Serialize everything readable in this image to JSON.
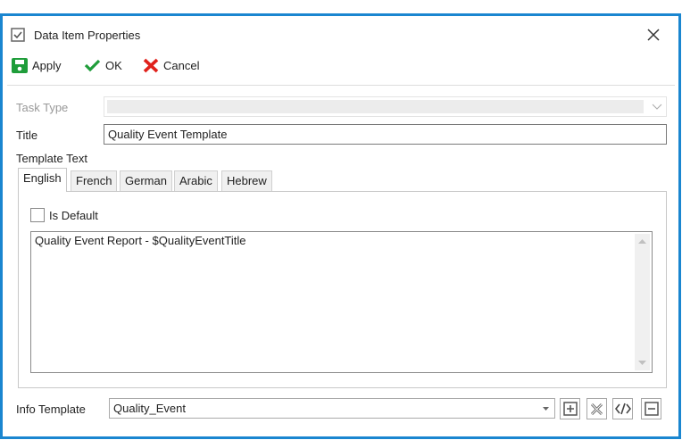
{
  "window": {
    "title": "Data Item Properties"
  },
  "toolbar": {
    "apply": "Apply",
    "ok": "OK",
    "cancel": "Cancel"
  },
  "form": {
    "task_type_label": "Task Type",
    "task_type_value": "",
    "title_label": "Title",
    "title_value": "Quality Event Template",
    "template_text_label": "Template Text",
    "tabs": [
      {
        "label": "English"
      },
      {
        "label": "French"
      },
      {
        "label": "German"
      },
      {
        "label": "Arabic"
      },
      {
        "label": "Hebrew"
      }
    ],
    "is_default_label": "Is Default",
    "is_default_checked": false,
    "template_body": "Quality Event Report - $QualityEventTitle",
    "info_template_label": "Info Template",
    "info_template_value": "Quality_Event"
  },
  "colors": {
    "frame": "#1a86d0",
    "apply": "#1f9d3a",
    "ok": "#1f9d3a",
    "cancel": "#e0211b"
  }
}
